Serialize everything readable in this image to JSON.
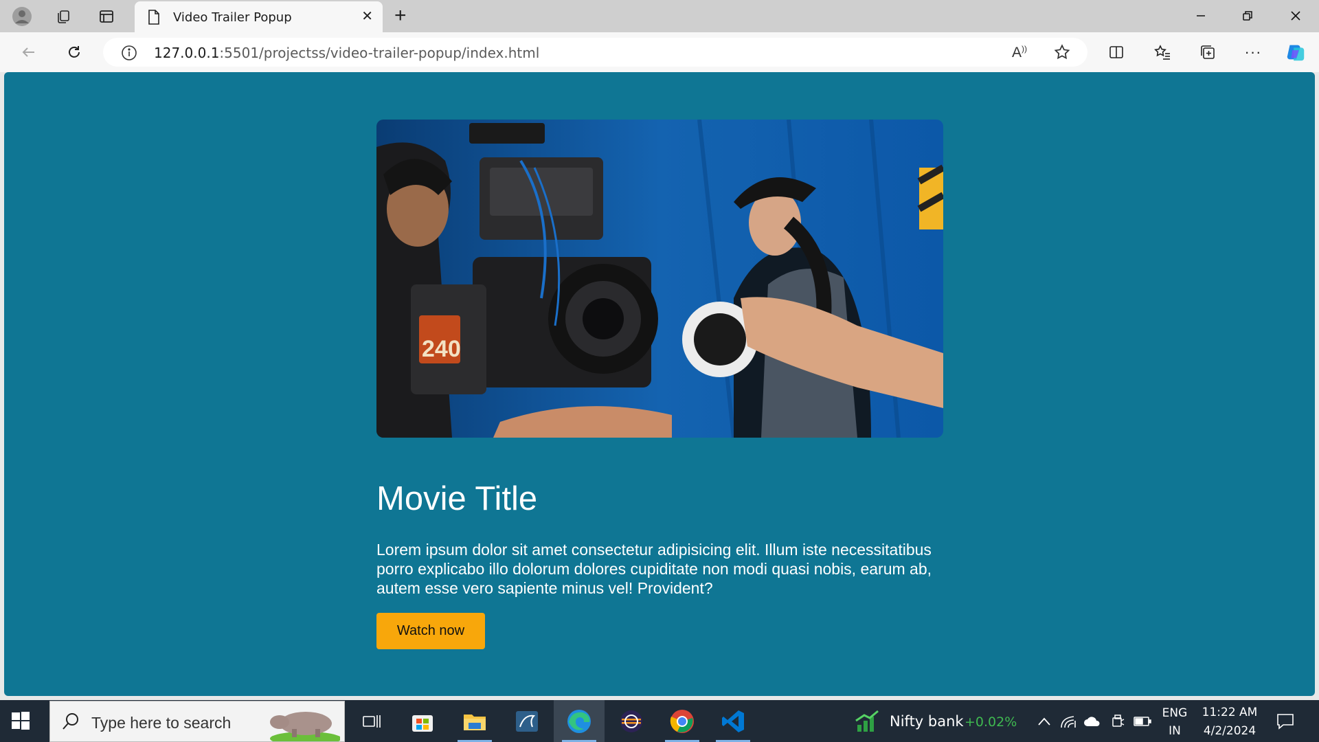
{
  "browser": {
    "tab": {
      "title": "Video Trailer Popup"
    },
    "address": {
      "host": "127.0.0.1",
      "path": ":5501/projectss/video-trailer-popup/index.html"
    }
  },
  "page": {
    "movie_title": "Movie Title",
    "description": "Lorem ipsum dolor sit amet consectetur adipisicing elit. Illum iste necessitatibus porro explicabo illo dolorum dolores cupiditate non modi quasi nobis, earum ab, autem esse vero sapiente minus vel! Provident?",
    "watch_button": "Watch now",
    "hero_image": "film-crew-camera-photo",
    "colors": {
      "background": "#0f7694",
      "button": "#f8a70b"
    }
  },
  "taskbar": {
    "search_placeholder": "Type here to search",
    "widget": {
      "label": "Nifty bank",
      "change": "+0.02%"
    },
    "language": {
      "line1": "ENG",
      "line2": "IN"
    },
    "clock": {
      "time": "11:22 AM",
      "date": "4/2/2024"
    }
  }
}
